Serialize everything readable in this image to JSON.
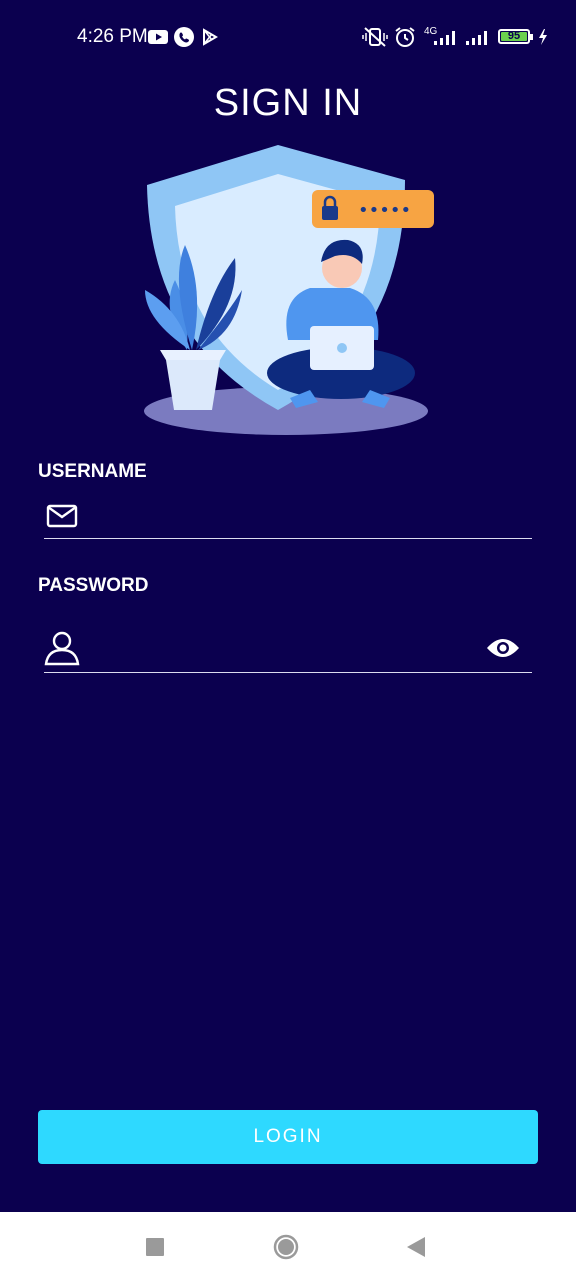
{
  "status_bar": {
    "time": "4:26 PM",
    "network": "4G",
    "battery": "95",
    "icons": [
      "youtube-icon",
      "phone-call-icon",
      "play-store-icon",
      "vibrate-mute-icon",
      "alarm-icon",
      "signal-icon",
      "signal-icon",
      "battery-icon",
      "charging-icon"
    ]
  },
  "page": {
    "title": "SIGN IN"
  },
  "form": {
    "username_label": "USERNAME",
    "username_value": "",
    "password_label": "PASSWORD",
    "password_value": "",
    "login_label": "LOGIN"
  },
  "illustration": {
    "password_dots": "•••••"
  },
  "colors": {
    "background": "#0b004f",
    "accent": "#2ed9ff",
    "nav_bar": "#ffffff"
  }
}
